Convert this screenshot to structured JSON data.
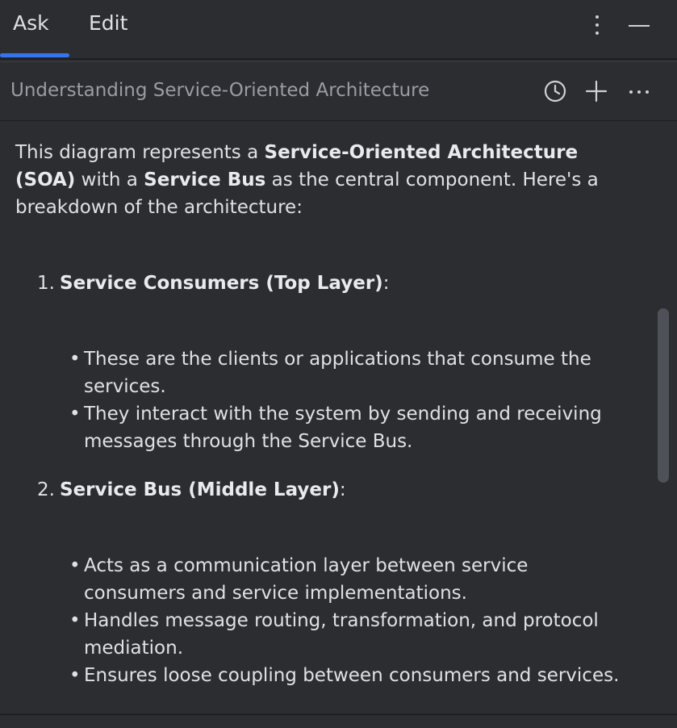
{
  "tabs": [
    {
      "label": "Ask",
      "active": true
    },
    {
      "label": "Edit",
      "active": false
    }
  ],
  "tabbar_actions": [
    "more-vertical-icon",
    "minimize-icon"
  ],
  "header": {
    "title": "Understanding Service-Oriented Architecture",
    "actions": [
      "history-icon",
      "add-icon",
      "more-horizontal-icon"
    ]
  },
  "content": {
    "intro": {
      "p1": "This diagram represents a ",
      "b1": "Service-Oriented Architecture (SOA)",
      "p2": " with a ",
      "b2": "Service Bus",
      "p3": " as the central component. Here's a breakdown of the architecture:"
    },
    "sections": [
      {
        "number": "1.",
        "title": "Service Consumers (Top Layer)",
        "suffix": ":",
        "bullets": [
          "These are the clients or applications that consume the services.",
          "They interact with the system by sending and receiving messages through the Service Bus."
        ]
      },
      {
        "number": "2.",
        "title": "Service Bus (Middle Layer)",
        "suffix": ":",
        "bullets": [
          "Acts as a communication layer between service consumers and service implementations.",
          "Handles message routing, transformation, and protocol mediation.",
          "Ensures loose coupling between consumers and services."
        ]
      }
    ]
  },
  "colors": {
    "background": "#2b2d30",
    "text": "#dfe1e5",
    "muted_text": "#9a9da3",
    "accent": "#3574f0",
    "divider": "#1e1f22",
    "scrollbar": "#4e5157"
  }
}
